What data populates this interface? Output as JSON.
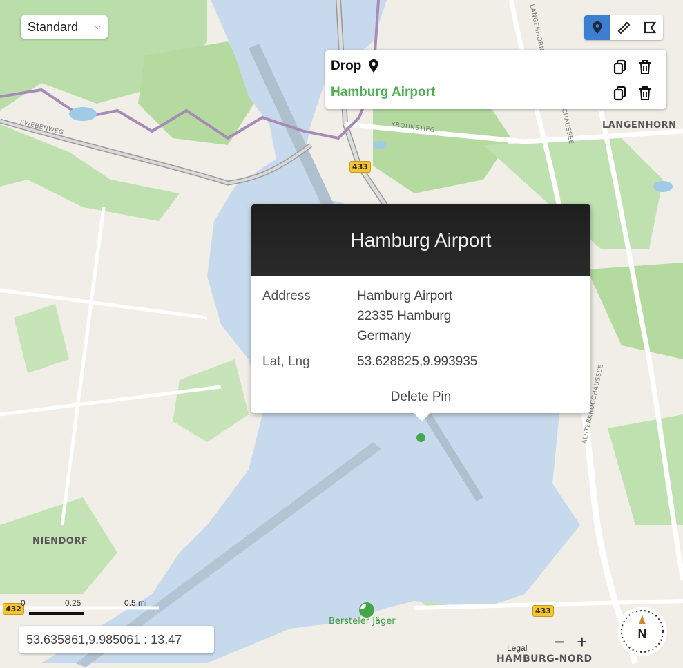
{
  "map_type": {
    "selected": "Standard"
  },
  "tools": [
    {
      "name": "pin-tool",
      "active": true
    },
    {
      "name": "ruler-tool",
      "active": false
    },
    {
      "name": "area-tool",
      "active": false
    }
  ],
  "pins_panel": {
    "rows": [
      {
        "label": "Drop",
        "color": "#111111"
      },
      {
        "label": "Hamburg Airport",
        "color": "#4caf50"
      }
    ]
  },
  "popup": {
    "title": "Hamburg Airport",
    "address_label": "Address",
    "address_lines": [
      "Hamburg Airport",
      "22335 Hamburg",
      "Germany"
    ],
    "latlng_label": "Lat, Lng",
    "latlng_value": "53.628825,9.993935",
    "delete_label": "Delete Pin"
  },
  "map_labels": {
    "swebenweg": "SWEBENWEG",
    "krohnstieg": "KROHNSTIEG",
    "langenhorn": "LANGENHORN",
    "niendorf": "NIENDORF",
    "hamburg_nord": "HAMBURG-NORD",
    "alsterkrug": "ALSTERKRUGCHAUSSEE",
    "langenhorner_ch": "LANGENHORNER CH",
    "chaussee": "CHAUSSEE",
    "poi_bersteler": "Bersteler Jäger"
  },
  "road_shields": [
    "433",
    "433",
    "432"
  ],
  "scale": {
    "labels": [
      "0",
      "0.25",
      "0.5 mi"
    ]
  },
  "coordinates": "53.635861,9.985061 : 13.47",
  "zoom": {
    "minus": "−",
    "plus": "+"
  },
  "compass": {
    "label": "N"
  },
  "legal": "Legal",
  "colors": {
    "water": "#c7daed",
    "park": "#b9deaa",
    "accent": "#3c7fd0",
    "pin": "#43a64a"
  }
}
